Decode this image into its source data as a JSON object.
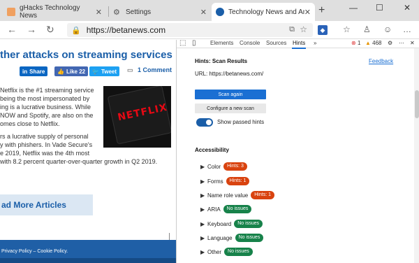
{
  "tabs": [
    {
      "label": "gHacks Technology News"
    },
    {
      "label": "Settings"
    },
    {
      "label": "Technology News and Analysis -"
    }
  ],
  "window": {
    "minimize": "—",
    "maximize": "☐",
    "close": "✕"
  },
  "address": {
    "url": "https://betanews.com"
  },
  "article": {
    "headline": "ther attacks on streaming services",
    "share_linkedin": "Share",
    "share_like": "Like 22",
    "share_tweet": "Tweet",
    "comments": "1 Comment",
    "para1": [
      "Netflix is the #1 streaming service",
      "being the most impersonated by",
      "ing is a lucrative business. While",
      "NOW and Spotify, are also on the",
      "omes close to Netflix."
    ],
    "para2": [
      "rs a lucrative supply of personal",
      "y with phishers. In Vade Secure's",
      "e 2019, Netflix was the 4th most",
      "with 8.2 percent quarter-over-quarter growth in Q2 2019."
    ],
    "image_logo": "NETFLIX",
    "read_more": "ad More Articles",
    "footer_text": "Privacy Policy – Cookie Policy."
  },
  "devtools": {
    "tabs": [
      "Elements",
      "Console",
      "Sources",
      "Hints"
    ],
    "active_tab": "Hints",
    "errors": "1",
    "warnings": "468",
    "title": "Hints: Scan Results",
    "feedback": "Feedback",
    "url_line": "URL: https://betanews.com/",
    "scan_again": "Scan again",
    "configure": "Configure a new scan",
    "show_passed": "Show passed hints",
    "section": "Accessibility",
    "categories": [
      {
        "label": "Color",
        "badge": "Hints: 3",
        "kind": "hint"
      },
      {
        "label": "Forms",
        "badge": "Hints: 1",
        "kind": "hint"
      },
      {
        "label": "Name role value",
        "badge": "Hints: 1",
        "kind": "hint"
      },
      {
        "label": "ARIA",
        "badge": "No issues",
        "kind": "ok"
      },
      {
        "label": "Keyboard",
        "badge": "No issues",
        "kind": "ok"
      },
      {
        "label": "Language",
        "badge": "No issues",
        "kind": "ok"
      },
      {
        "label": "Other",
        "badge": "No issues",
        "kind": "ok"
      }
    ]
  },
  "colors": {
    "accent": "#1a6fd3",
    "hint_badge": "#d9430f",
    "ok_badge": "#17824a",
    "page_link": "#1a5ea8"
  }
}
